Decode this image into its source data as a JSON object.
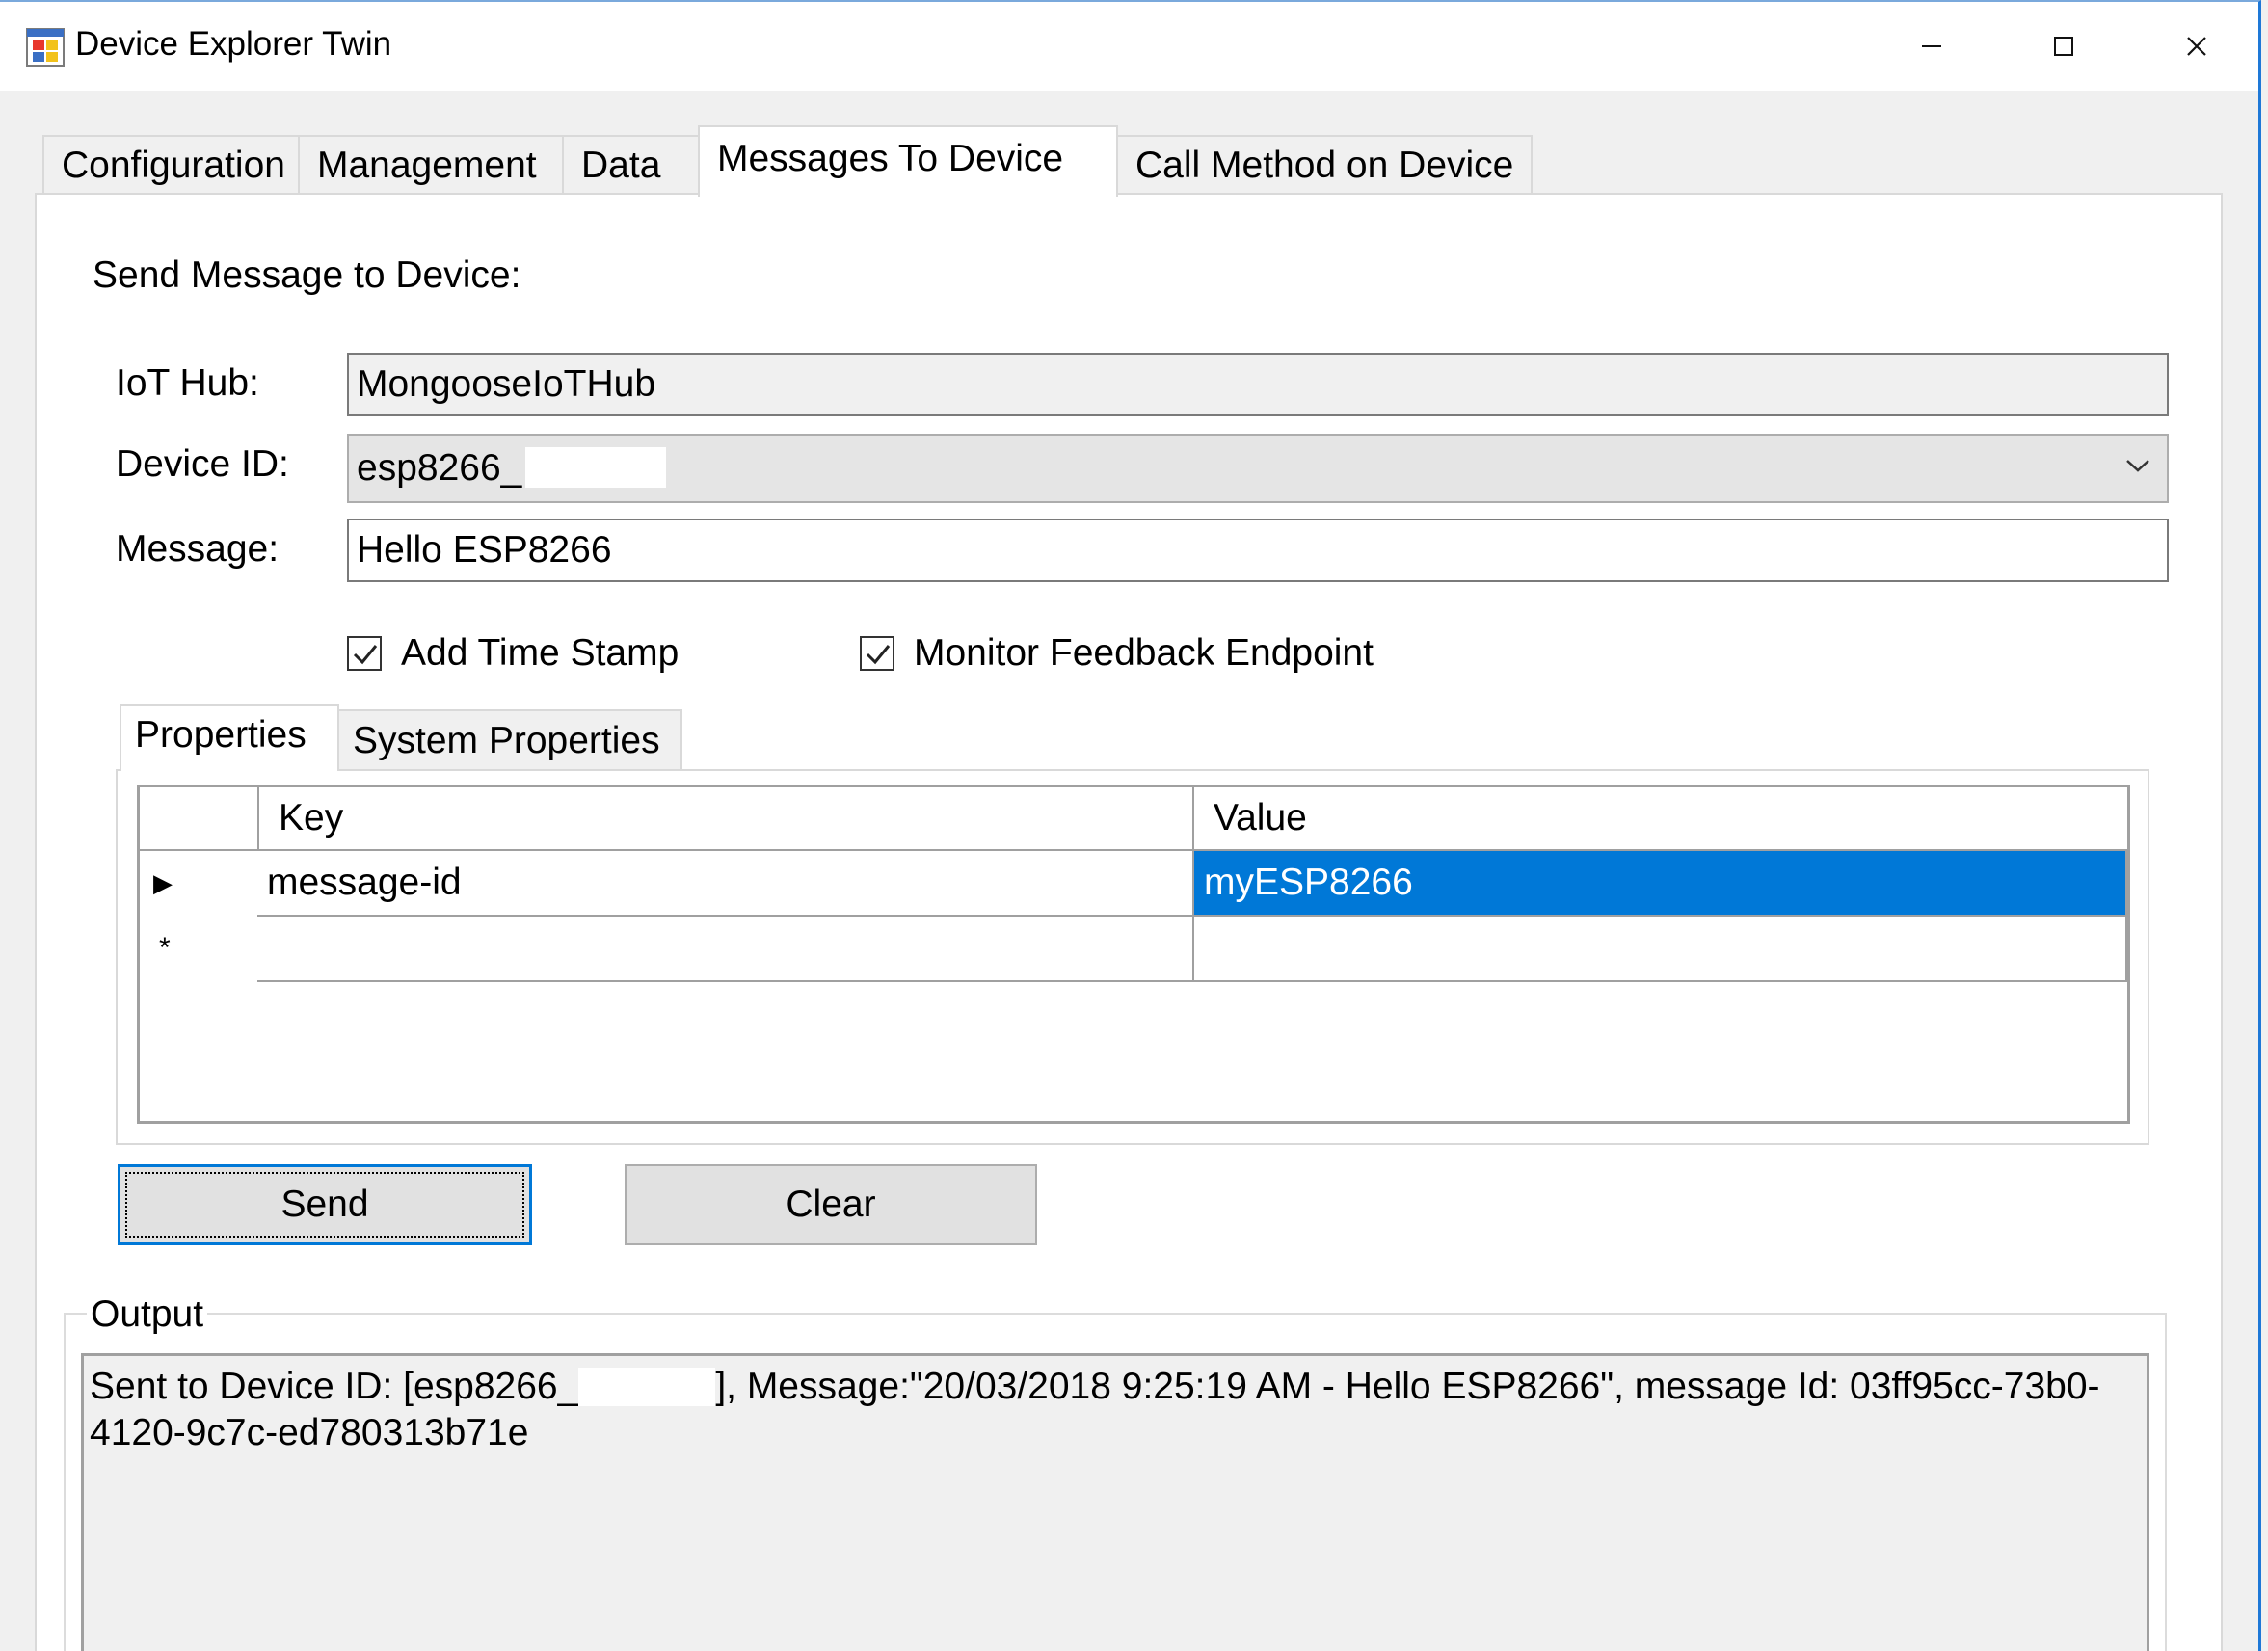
{
  "window": {
    "title": "Device Explorer Twin",
    "controls": {
      "minimize": "–",
      "maximize": "☐",
      "close": "✕"
    }
  },
  "main_tabs": [
    {
      "label": "Configuration"
    },
    {
      "label": "Management"
    },
    {
      "label": "Data"
    },
    {
      "label": "Messages To Device"
    },
    {
      "label": "Call Method on Device"
    }
  ],
  "active_main_tab": "Messages To Device",
  "send_section": {
    "heading": "Send Message to Device:",
    "iot_hub_label": "IoT Hub:",
    "iot_hub_value": "MongooseIoTHub",
    "device_id_label": "Device ID:",
    "device_id_value": "esp8266_",
    "message_label": "Message:",
    "message_value": "Hello ESP8266",
    "add_timestamp_label": "Add Time Stamp",
    "add_timestamp_checked": true,
    "monitor_feedback_label": "Monitor Feedback Endpoint",
    "monitor_feedback_checked": true
  },
  "property_tabs": [
    {
      "label": "Properties"
    },
    {
      "label": "System Properties"
    }
  ],
  "properties_grid": {
    "columns": [
      "Key",
      "Value"
    ],
    "rows": [
      {
        "indicator": "▶",
        "key": "message-id",
        "value": "myESP8266"
      },
      {
        "indicator": "*",
        "key": "",
        "value": ""
      }
    ]
  },
  "buttons": {
    "send": "Send",
    "clear": "Clear"
  },
  "output": {
    "legend": "Output",
    "text_line1_a": "Sent to Device ID: [esp8266_",
    "text_line1_b": "], Message:\"20/03/2018 9:25:19 AM - Hello ESP8266\", message Id: 03ff95cc-73b0-",
    "text_line2": "4120-9c7c-ed780313b71e"
  },
  "colors": {
    "selection": "#0078d7",
    "window_border": "#1e78d7",
    "background": "#f0f0f0"
  }
}
